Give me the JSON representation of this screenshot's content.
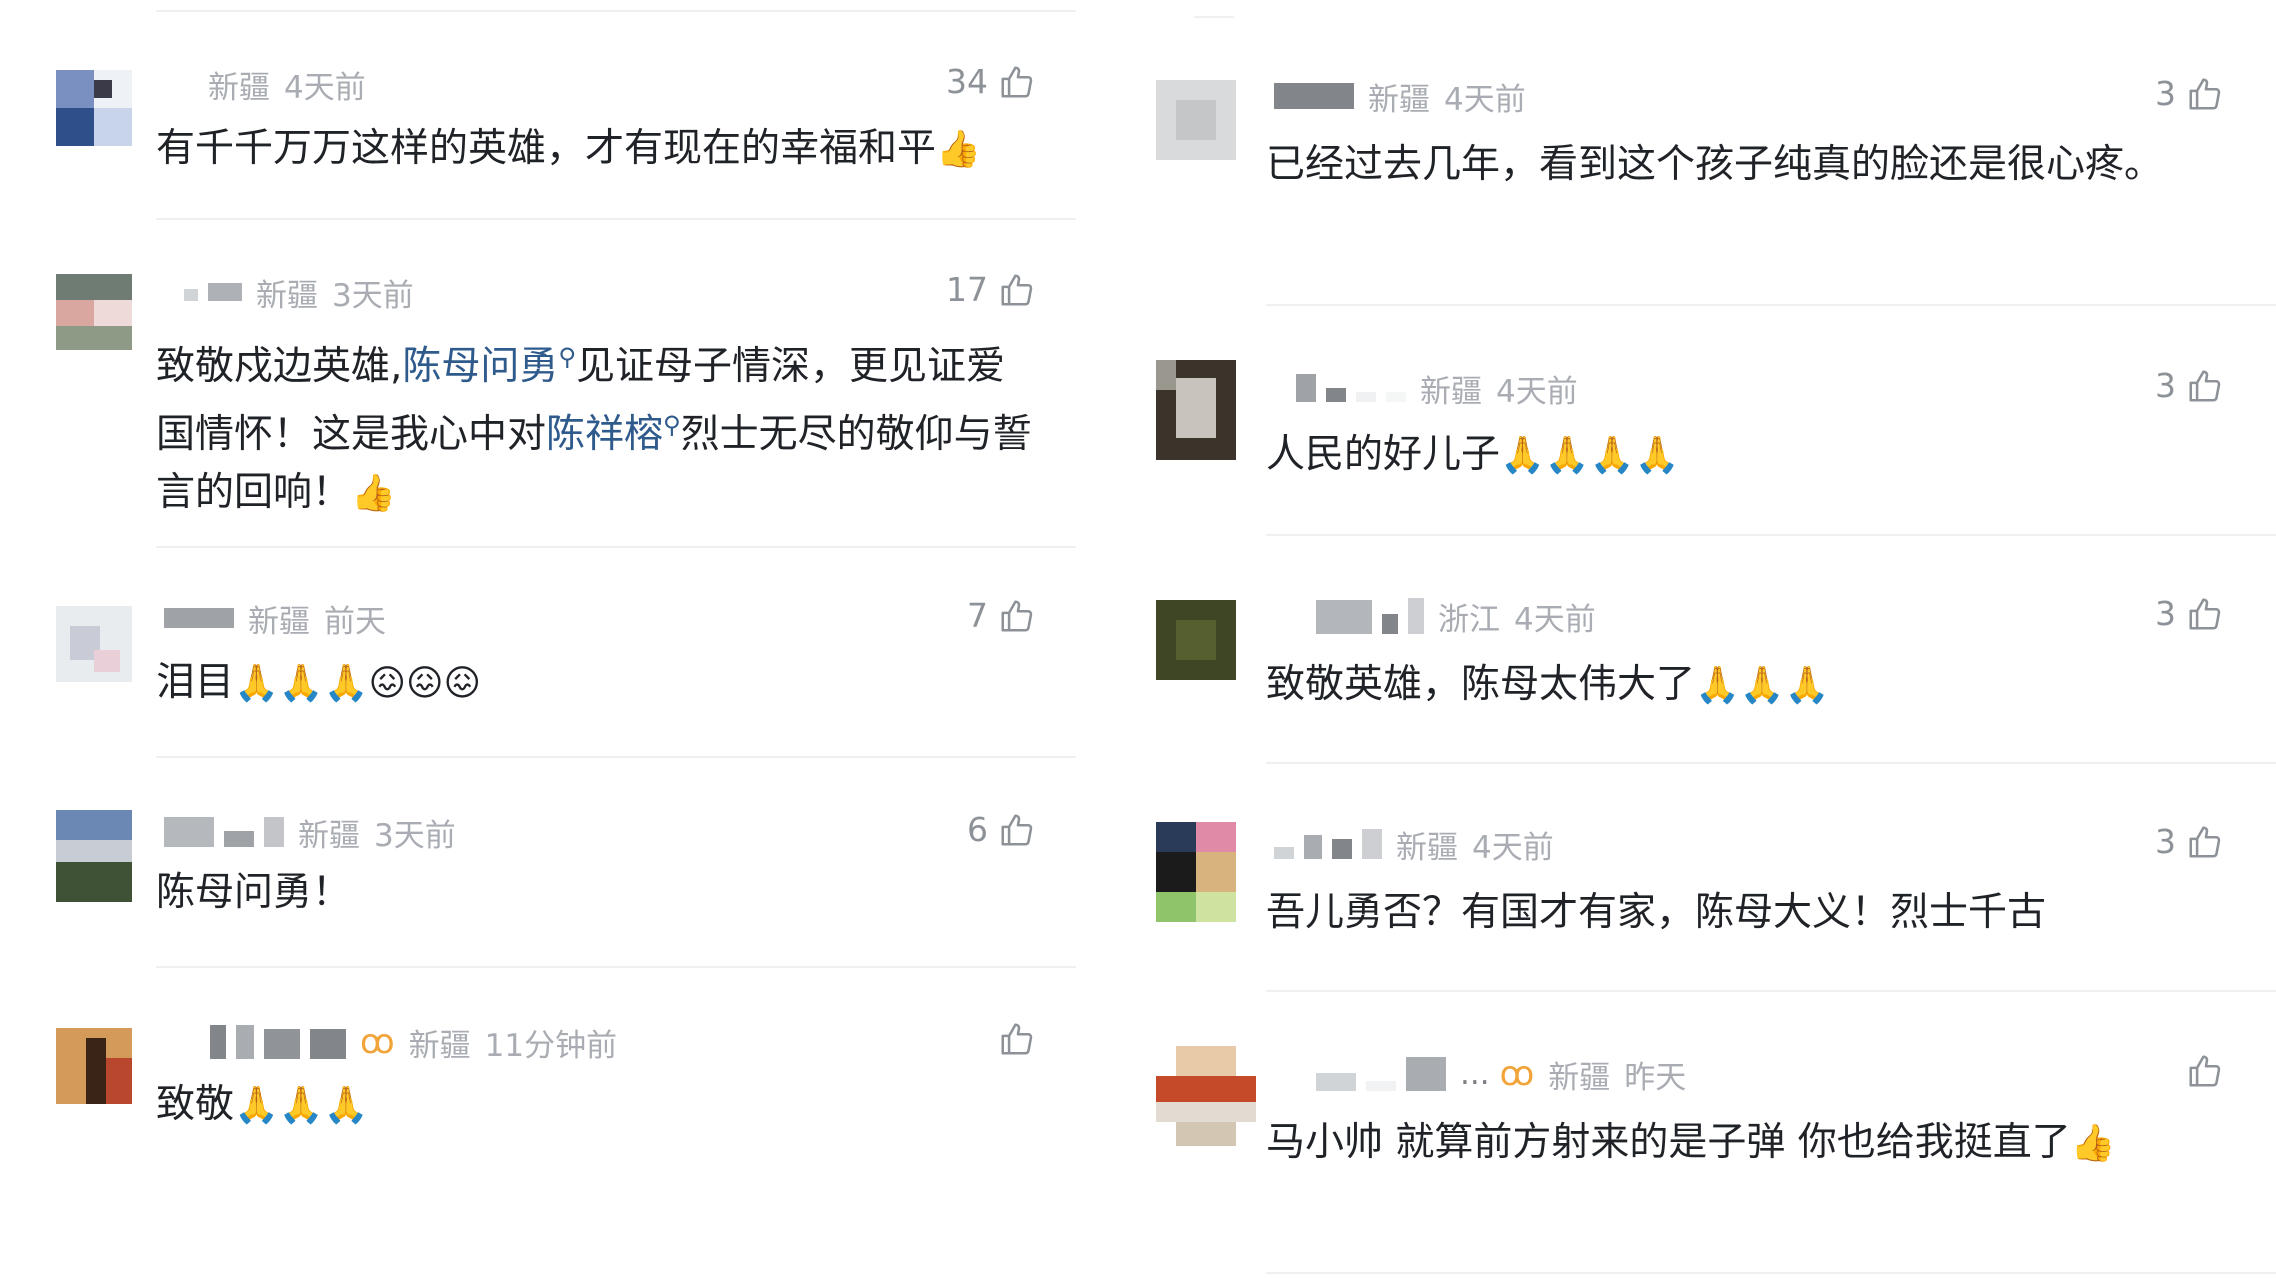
{
  "left_comments": [
    {
      "location": "新疆",
      "time": "4天前",
      "likes": "34",
      "text": [
        {
          "t": "有千千万万这样的英雄，才有现在的幸福和平"
        },
        {
          "e": "👍"
        }
      ]
    },
    {
      "location": "新疆",
      "time": "3天前",
      "likes": "17",
      "text": [
        {
          "t": "致敬戍边英雄,"
        },
        {
          "l": "陈母问勇"
        },
        {
          "t": "见证母子情深，更见证爱国情怀！这是我心中对"
        },
        {
          "l": "陈祥榕"
        },
        {
          "t": "烈士无尽的敬仰与誓言的回响！"
        },
        {
          "e": "👍"
        }
      ]
    },
    {
      "location": "新疆",
      "time": "前天",
      "likes": "7",
      "text": [
        {
          "t": "泪目"
        },
        {
          "e": "🙏🙏🙏😖😖😖"
        }
      ]
    },
    {
      "location": "新疆",
      "time": "3天前",
      "likes": "6",
      "text": [
        {
          "t": "陈母问勇！"
        }
      ]
    },
    {
      "location": "新疆",
      "time": "11分钟前",
      "likes": "",
      "badge": "ꝏ",
      "text": [
        {
          "t": "致敬"
        },
        {
          "e": "🙏🙏🙏"
        }
      ]
    }
  ],
  "right_comments": [
    {
      "location": "新疆",
      "time": "4天前",
      "likes": "3",
      "text": [
        {
          "t": "已经过去几年，看到这个孩子纯真的脸还是很心疼。"
        }
      ]
    },
    {
      "location": "新疆",
      "time": "4天前",
      "likes": "3",
      "text": [
        {
          "t": "人民的好儿子"
        },
        {
          "e": "🙏🙏🙏🙏"
        }
      ]
    },
    {
      "location": "浙江",
      "time": "4天前",
      "likes": "3",
      "text": [
        {
          "t": "致敬英雄，陈母太伟大了"
        },
        {
          "e": "🙏🙏🙏"
        }
      ]
    },
    {
      "location": "新疆",
      "time": "4天前",
      "likes": "3",
      "text": [
        {
          "t": "吾儿勇否？有国才有家，陈母大义！烈士千古"
        }
      ]
    },
    {
      "location": "新疆",
      "time": "昨天",
      "likes": "",
      "badge": "ꝏ",
      "ellipsis": "...",
      "text": [
        {
          "t": "马小帅  就算前方射来的是子弹 你也给我挺直了"
        },
        {
          "e": "👍"
        }
      ]
    }
  ],
  "colors": {
    "meta": "#a9adb3",
    "text": "#1f2227",
    "link": "#2f5a8c",
    "badge": "#f0a43a",
    "separator": "#eef0f2"
  },
  "icons": {
    "like": "thumbs-up-icon",
    "topic": "search-icon",
    "vip": "vip-badge-icon",
    "avatar": "avatar"
  }
}
